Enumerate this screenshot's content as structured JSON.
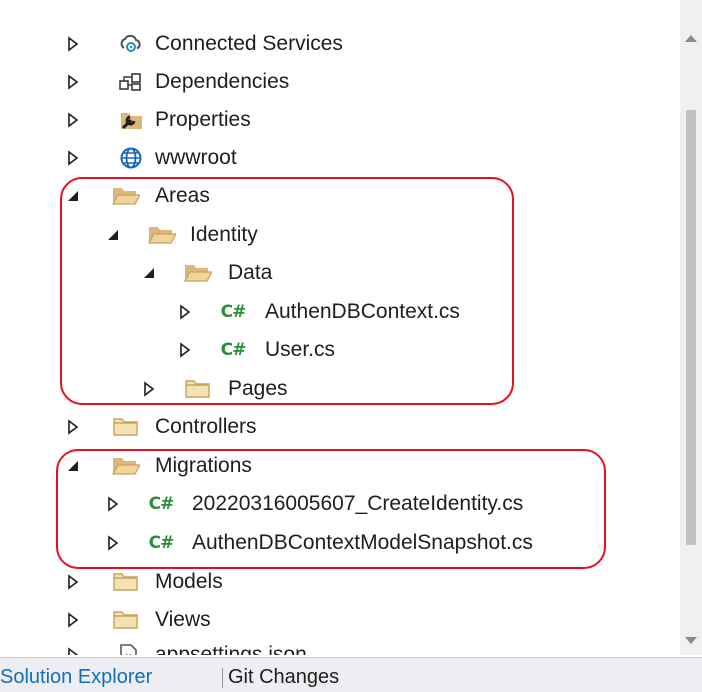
{
  "tree": [
    {
      "label": "Connected Services",
      "icon": "connected-services-icon",
      "expanded": false,
      "level": 0
    },
    {
      "label": "Dependencies",
      "icon": "dependencies-icon",
      "expanded": false,
      "level": 0
    },
    {
      "label": "Properties",
      "icon": "properties-icon",
      "expanded": false,
      "level": 0
    },
    {
      "label": "wwwroot",
      "icon": "globe-icon",
      "expanded": false,
      "level": 0
    },
    {
      "label": "Areas",
      "icon": "folder-open-icon",
      "expanded": true,
      "level": 0
    },
    {
      "label": "Identity",
      "icon": "folder-open-icon",
      "expanded": true,
      "level": 1
    },
    {
      "label": "Data",
      "icon": "folder-open-icon",
      "expanded": true,
      "level": 2
    },
    {
      "label": "AuthenDBContext.cs",
      "icon": "csharp-file-icon",
      "expanded": false,
      "level": 3
    },
    {
      "label": "User.cs",
      "icon": "csharp-file-icon",
      "expanded": false,
      "level": 3
    },
    {
      "label": "Pages",
      "icon": "folder-icon",
      "expanded": false,
      "level": 2
    },
    {
      "label": "Controllers",
      "icon": "folder-icon",
      "expanded": false,
      "level": 0
    },
    {
      "label": "Migrations",
      "icon": "folder-open-icon",
      "expanded": true,
      "level": 0
    },
    {
      "label": "20220316005607_CreateIdentity.cs",
      "icon": "csharp-file-icon",
      "expanded": false,
      "level": 1
    },
    {
      "label": "AuthenDBContextModelSnapshot.cs",
      "icon": "csharp-file-icon",
      "expanded": false,
      "level": 1
    },
    {
      "label": "Models",
      "icon": "folder-icon",
      "expanded": false,
      "level": 0
    },
    {
      "label": "Views",
      "icon": "folder-icon",
      "expanded": false,
      "level": 0
    },
    {
      "label": "appsettings.json",
      "icon": "json-file-icon",
      "expanded": false,
      "level": 0
    }
  ],
  "cs_badge": "C#",
  "tabs": {
    "solution_explorer": "Solution Explorer",
    "git_changes": "Git Changes"
  },
  "colors": {
    "highlight": "#e8101d",
    "active_tab": "#0e70c0",
    "folder": "#dcb67a",
    "csharp": "#2a8f3a"
  }
}
